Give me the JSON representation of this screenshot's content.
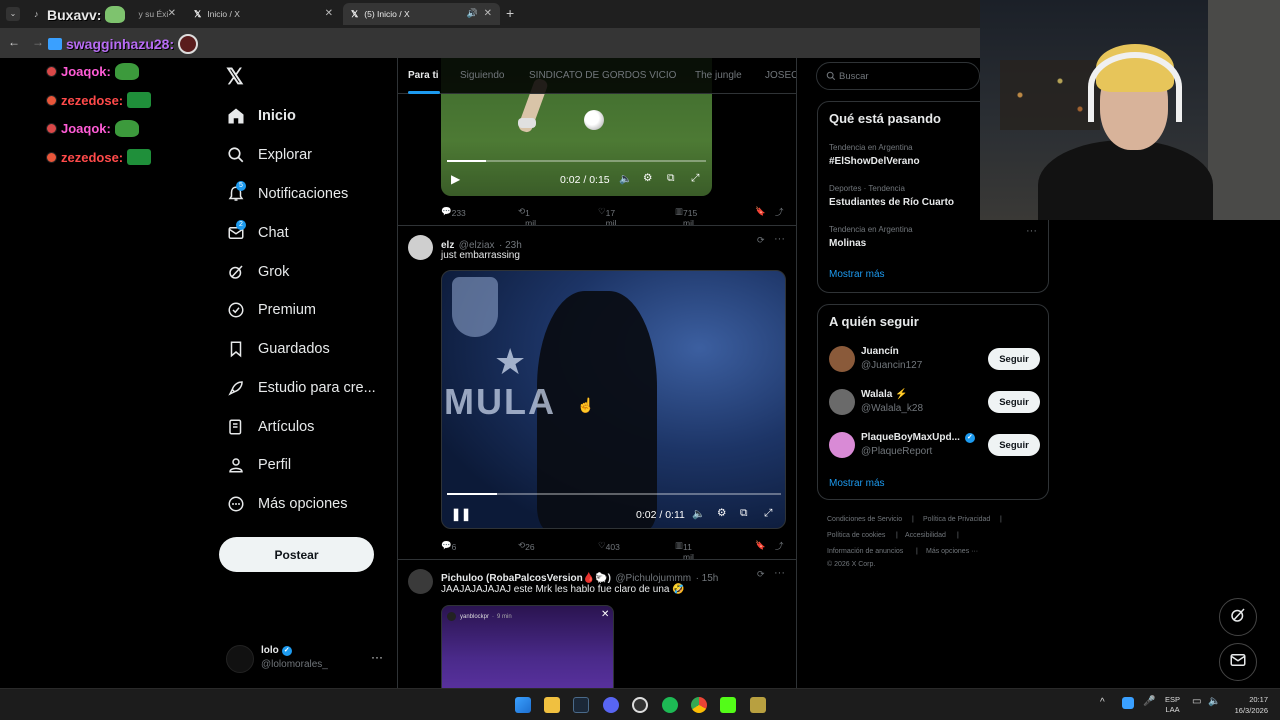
{
  "browser": {
    "tabs": [
      {
        "label": "Buxavv:",
        "sub": "y su Éxi"
      },
      {
        "label": "Inicio / X"
      },
      {
        "label": "(5) Inicio / X"
      }
    ],
    "addr_overlay": "swagginhazu28:"
  },
  "chat_overlay": [
    {
      "user": "Joaqok:",
      "color": "#ff5cd6",
      "badge": "#d94848"
    },
    {
      "user": "zezedose:",
      "color": "#ff4a4a",
      "badge": "#e8563a"
    },
    {
      "user": "Joaqok:",
      "color": "#ff5cd6",
      "badge": "#d94848"
    },
    {
      "user": "zezedose:",
      "color": "#ff4a4a",
      "badge": "#e8563a"
    }
  ],
  "nav": {
    "logo": "𝕏",
    "items": [
      {
        "label": "Inicio",
        "icon": "home-icon"
      },
      {
        "label": "Explorar",
        "icon": "search-icon"
      },
      {
        "label": "Notificaciones",
        "icon": "bell-icon",
        "badge": "5"
      },
      {
        "label": "Chat",
        "icon": "mail-icon",
        "badge": "2"
      },
      {
        "label": "Grok",
        "icon": "grok-icon"
      },
      {
        "label": "Premium",
        "icon": "verified-icon"
      },
      {
        "label": "Guardados",
        "icon": "bookmark-icon"
      },
      {
        "label": "Estudio para cre...",
        "icon": "rocket-icon"
      },
      {
        "label": "Artículos",
        "icon": "article-icon"
      },
      {
        "label": "Perfil",
        "icon": "person-icon"
      },
      {
        "label": "Más opciones",
        "icon": "more-circle-icon"
      }
    ],
    "post_label": "Postear",
    "account_name": "lolo",
    "account_handle": "@lolomorales_"
  },
  "feed": {
    "tabs": [
      "Para ti",
      "Siguiendo",
      "SINDICATO DE GORDOS VICIO",
      "The jungle",
      "JOSEO"
    ],
    "tweets": [
      {
        "video_time": "0:02 / 0:15",
        "video_progress": 0.15,
        "replies": "233",
        "retweets": "1 mil",
        "likes": "17 mil",
        "views": "715 mil"
      },
      {
        "name": "elz",
        "handle": "@elziax",
        "time": "· 23h",
        "text": "just embarrassing",
        "video_time": "0:02 / 0:11",
        "video_progress": 0.15,
        "video_caption": "MULA",
        "replies": "6",
        "retweets": "26",
        "likes": "403",
        "views": "11 mil"
      },
      {
        "name": "Pichuloo (RobaPalcosVersion🩸🐑)",
        "handle": "@Pichulojummm",
        "time": "· 15h",
        "text": "JAAJAJAJAJAJ este Mrk les hablo fue claro de una 🤣",
        "embed_user": "yanblockpr",
        "embed_time": "9 min"
      }
    ]
  },
  "right": {
    "search_placeholder": "Buscar",
    "trends_title": "Qué está pasando",
    "trends": [
      {
        "meta": "Tendencia en Argentina",
        "name": "#ElShowDelVerano"
      },
      {
        "meta": "Deportes · Tendencia",
        "name": "Estudiantes de Río Cuarto"
      },
      {
        "meta": "Tendencia en Argentina",
        "name": "Molinas"
      }
    ],
    "show_more": "Mostrar más",
    "follow_title": "A quién seguir",
    "follow": [
      {
        "name": "Juancín",
        "handle": "@Juancin127",
        "button": "Seguir"
      },
      {
        "name": "Walala ⚡",
        "handle": "@Walala_k28",
        "button": "Seguir"
      },
      {
        "name": "PlaqueBoyMaxUpd...",
        "handle": "@PlaqueReport",
        "button": "Seguir"
      }
    ],
    "follow_more": "Mostrar más",
    "footer": [
      "Condiciones de Servicio",
      "Política de Privacidad",
      "Política de cookies",
      "Accesibilidad",
      "Información de anuncios",
      "Más opciones ···",
      "© 2026 X Corp."
    ]
  },
  "taskbar": {
    "lang": "ESP",
    "lang2": "LAA",
    "time": "20:17",
    "date": "16/3/2026"
  },
  "colors": {
    "accent": "#1d9bf0",
    "bg": "#000000",
    "border": "#2f3336"
  }
}
